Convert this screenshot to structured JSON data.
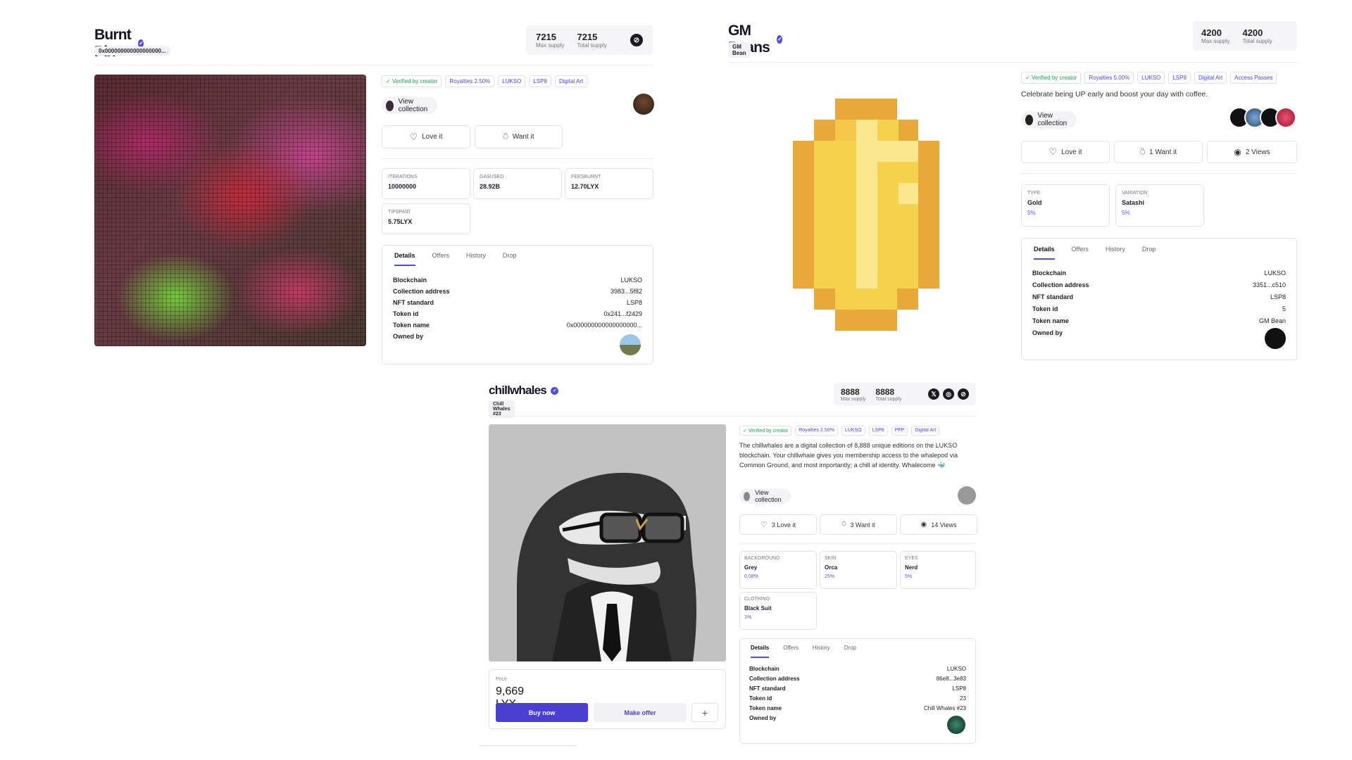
{
  "burnt": {
    "title": "Burnt Pix",
    "subtitle": "0x000000000000000000...",
    "max_supply": "7215",
    "max_supply_label": "Max supply",
    "total_supply": "7215",
    "total_supply_label": "Total supply",
    "tags": [
      "Verified by creator",
      "Royalties 2.50%",
      "LUKSO",
      "LSP8",
      "Digital Art"
    ],
    "view_collection": "View collection",
    "love": "Love it",
    "want": "Want it",
    "props": [
      {
        "k": "ITERATIONS",
        "v": "10000000"
      },
      {
        "k": "GASUSED",
        "v": "28.92B"
      },
      {
        "k": "FEESBURNT",
        "v": "12.70LYX"
      },
      {
        "k": "TIPSPAID",
        "v": "5.75LYX"
      }
    ],
    "tabs": [
      "Details",
      "Offers",
      "History",
      "Drop"
    ],
    "details": [
      {
        "l": "Blockchain",
        "v": "LUKSO"
      },
      {
        "l": "Collection address",
        "v": "3983...5f82"
      },
      {
        "l": "NFT standard",
        "v": "LSP8"
      },
      {
        "l": "Token id",
        "v": "0x241...f2429"
      },
      {
        "l": "Token name",
        "v": "0x000000000000000000..."
      },
      {
        "l": "Owned by",
        "v": ""
      }
    ]
  },
  "gm": {
    "title": "GM Beans",
    "subtitle": "GM Bean",
    "max_supply": "4200",
    "max_supply_label": "Max supply",
    "total_supply": "4200",
    "total_supply_label": "Total supply",
    "tags": [
      "Verified by creator",
      "Royalties 5.00%",
      "LUKSO",
      "LSP8",
      "Digital Art",
      "Access Passes"
    ],
    "description": "Celebrate being UP early and boost your day with coffee.",
    "view_collection": "View collection",
    "love": "Love it",
    "want": "1 Want it",
    "views": "2 Views",
    "props": [
      {
        "k": "TYPE",
        "v": "Gold",
        "p": "5%"
      },
      {
        "k": "VARIATION",
        "v": "Satashi",
        "p": "5%"
      }
    ],
    "tabs": [
      "Details",
      "Offers",
      "History",
      "Drop"
    ],
    "details": [
      {
        "l": "Blockchain",
        "v": "LUKSO"
      },
      {
        "l": "Collection address",
        "v": "3351...c510"
      },
      {
        "l": "NFT standard",
        "v": "LSP8"
      },
      {
        "l": "Token id",
        "v": "5"
      },
      {
        "l": "Token name",
        "v": "GM Bean"
      },
      {
        "l": "Owned by",
        "v": ""
      }
    ]
  },
  "chill": {
    "title": "chillwhales",
    "subtitle": "Chill Whales #23",
    "max_supply": "8888",
    "max_supply_label": "Max supply",
    "total_supply": "8888",
    "total_supply_label": "Total supply",
    "tags": [
      "Verified by creator",
      "Royalties 2.50%",
      "LUKSO",
      "LSP8",
      "PFP",
      "Digital Art"
    ],
    "description": "The chillwhales are a digital collection of 8,888 unique editions on the LUKSO blockchain. Your chillwhale gives you membership access to the whalepod via Common Ground, and most importantly; a chill af identity. Whalecome 🐳",
    "view_collection": "View collection",
    "love": "3 Love it",
    "want": "3 Want it",
    "views": "14 Views",
    "props": [
      {
        "k": "BACKGROUND",
        "v": "Grey",
        "p": "0.08%"
      },
      {
        "k": "SKIN",
        "v": "Orca",
        "p": "25%"
      },
      {
        "k": "EYES",
        "v": "Nerd",
        "p": "5%"
      },
      {
        "k": "CLOTHING",
        "v": "Black Suit",
        "p": "1%"
      }
    ],
    "price_label": "Price",
    "price": "9,669 LYX",
    "buy": "Buy now",
    "offer": "Make offer",
    "plus": "+",
    "tabs": [
      "Details",
      "Offers",
      "History",
      "Drop"
    ],
    "details": [
      {
        "l": "Blockchain",
        "v": "LUKSO"
      },
      {
        "l": "Collection address",
        "v": "86e8...3e83"
      },
      {
        "l": "NFT standard",
        "v": "LSP8"
      },
      {
        "l": "Token id",
        "v": "23"
      },
      {
        "l": "Token name",
        "v": "Chill Whales #23"
      },
      {
        "l": "Owned by",
        "v": ""
      }
    ]
  }
}
